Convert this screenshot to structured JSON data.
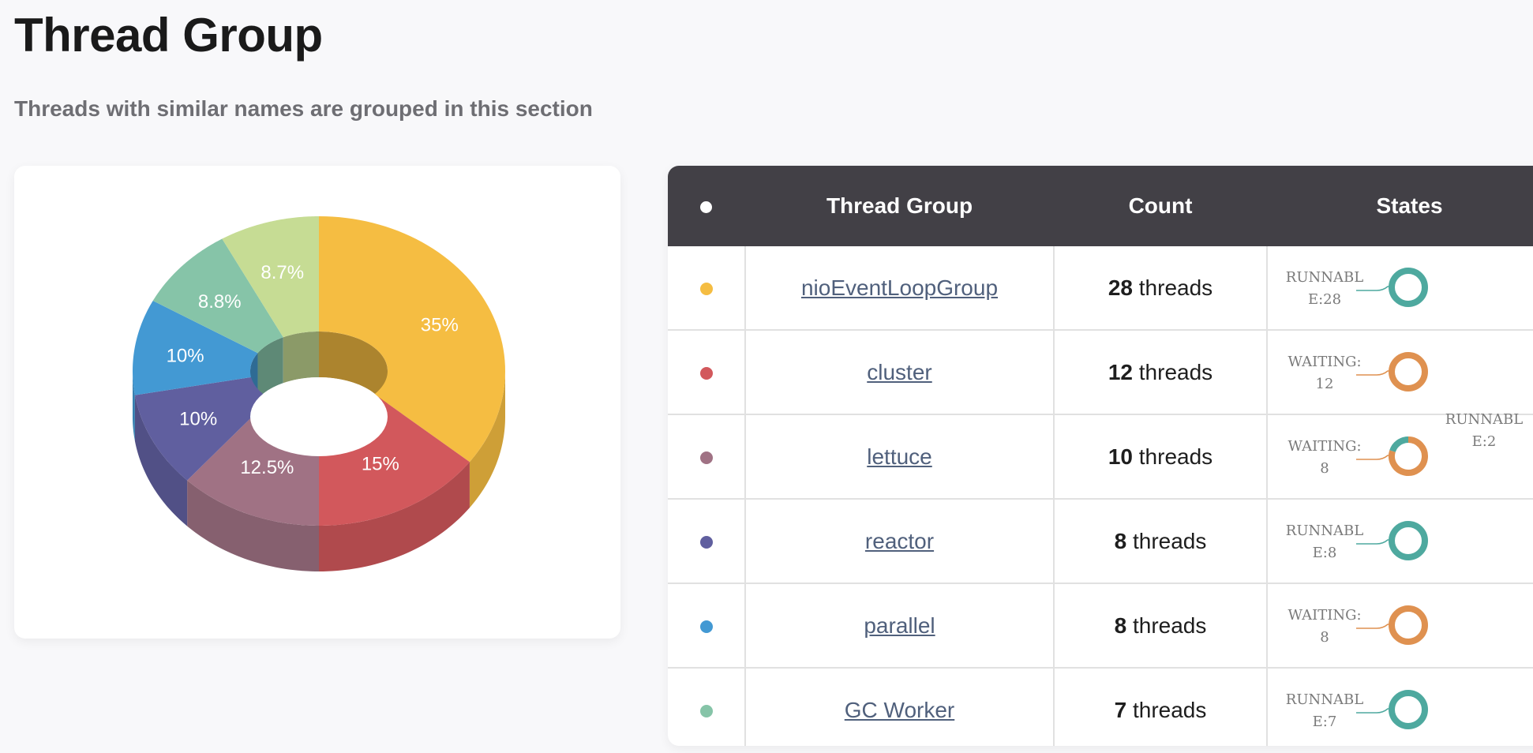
{
  "page": {
    "title": "Thread Group",
    "subtitle": "Threads with similar names are grouped in this section"
  },
  "table": {
    "headers": [
      "Thread Group",
      "Count",
      "States"
    ],
    "threads_suffix": "threads",
    "rows": [
      {
        "color": "#f5bd42",
        "name": "nioEventLoopGroup",
        "count": "28",
        "states": [
          {
            "label": "RUNNABLE:28",
            "color": "#4ea99f",
            "value": 28
          }
        ]
      },
      {
        "color": "#d2585c",
        "name": "cluster",
        "count": "12",
        "states": [
          {
            "label": "WAITING:12",
            "color": "#df9150",
            "value": 12
          }
        ]
      },
      {
        "color": "#a07284",
        "name": "lettuce",
        "count": "10",
        "states": [
          {
            "label": "WAITING:8",
            "color": "#df9150",
            "value": 8
          },
          {
            "label": "RUNNABLE:2",
            "color": "#4ea99f",
            "value": 2
          }
        ]
      },
      {
        "color": "#605f9f",
        "name": "reactor",
        "count": "8",
        "states": [
          {
            "label": "RUNNABLE:8",
            "color": "#4ea99f",
            "value": 8
          }
        ]
      },
      {
        "color": "#4399d3",
        "name": "parallel",
        "count": "8",
        "states": [
          {
            "label": "WAITING:8",
            "color": "#df9150",
            "value": 8
          }
        ]
      },
      {
        "color": "#86c4a8",
        "name": "GC Worker",
        "count": "7",
        "states": [
          {
            "label": "RUNNABLE:7",
            "color": "#4ea99f",
            "value": 7
          }
        ]
      }
    ]
  },
  "chart_data": {
    "type": "pie",
    "labels": [
      "35%",
      "15%",
      "12.5%",
      "10%",
      "10%",
      "8.8%",
      "8.7%"
    ],
    "values": [
      35,
      15,
      12.5,
      10,
      10,
      8.8,
      8.7
    ],
    "colors": [
      "#f5bd42",
      "#d2585c",
      "#a07284",
      "#605f9f",
      "#4399d3",
      "#86c4a8",
      "#c6dc94"
    ]
  }
}
